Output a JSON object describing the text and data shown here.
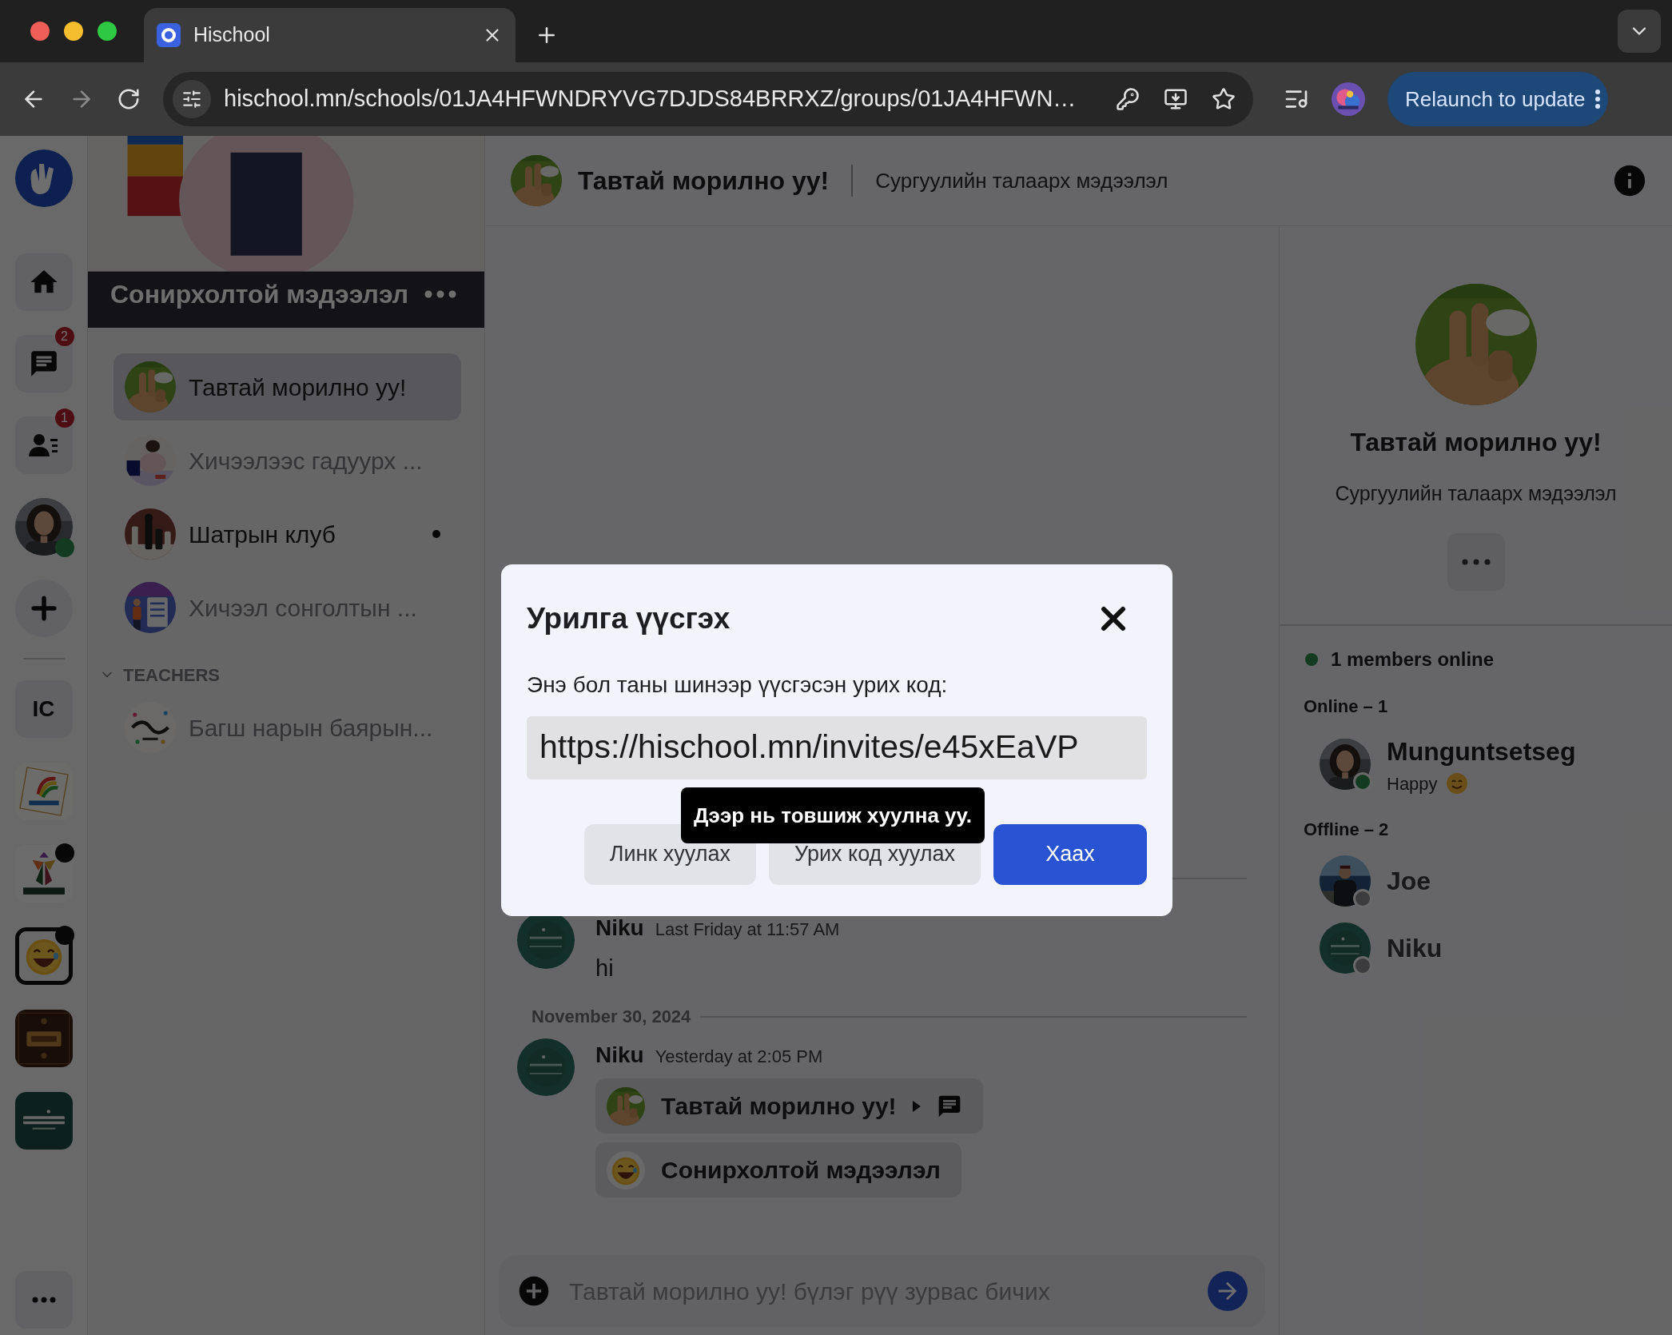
{
  "browser": {
    "tab_title": "Hischool",
    "url": "hischool.mn/schools/01JA4HFWNDRYVG7DJDS84BRRXZ/groups/01JA4HFWN…",
    "update_button": "Relaunch to update"
  },
  "rail": {
    "chat_badge": "2",
    "contacts_badge": "1",
    "user_online": true,
    "servers": [
      {
        "kind": "text",
        "label": "IC",
        "selected": false,
        "unread": false
      },
      {
        "kind": "picture",
        "selected": false,
        "unread": false
      },
      {
        "kind": "picture",
        "selected": false,
        "unread": true
      },
      {
        "kind": "picture",
        "selected": true,
        "unread": true
      },
      {
        "kind": "picture",
        "selected": false,
        "unread": false
      },
      {
        "kind": "picture",
        "selected": false,
        "unread": false
      }
    ]
  },
  "group": {
    "banner_title": "Сонирхолтой мэдээлэл",
    "channels": [
      {
        "name": "Тавтай морилно уу!",
        "selected": true,
        "unread": false
      },
      {
        "name": "Хичээлээс гадуурх ...",
        "selected": false,
        "unread": false
      },
      {
        "name": "Шатрын клуб",
        "selected": false,
        "unread": true
      },
      {
        "name": "Хичээл сонголтын ...",
        "selected": false,
        "unread": false
      }
    ],
    "categories": [
      {
        "name": "TEACHERS",
        "expanded": true,
        "channels": [
          {
            "name": "Багш нарын баярын...",
            "selected": false,
            "unread": false
          }
        ]
      }
    ]
  },
  "header": {
    "title": "Тавтай морилно уу!",
    "subtitle": "Сургуулийн талаарх мэдээлэл"
  },
  "messages": [
    {
      "kind": "message",
      "author": "Niku",
      "time": "Last Friday at 11:57 AM",
      "text": "hi"
    },
    {
      "kind": "date",
      "label": "November 30, 2024"
    },
    {
      "kind": "message",
      "author": "Niku",
      "time": "Yesterday at 2:05 PM",
      "channel_links": [
        {
          "name": "Тавтай морилно уу!",
          "expandable": true
        },
        {
          "name": "Сонирхолтой мэдээлэл",
          "expandable": false
        }
      ]
    }
  ],
  "composer": {
    "placeholder": "Тавтай морилно уу! бүлэг рүү зурвас бичих"
  },
  "info_panel": {
    "title": "Тавтай морилно уу!",
    "subtitle": "Сургуулийн талаарх мэдээлэл",
    "online_summary": "1 members online",
    "groups": [
      {
        "label": "Online – 1",
        "members": [
          {
            "name": "Munguntsetseg",
            "status_text": "Happy",
            "online": true
          }
        ]
      },
      {
        "label": "Offline – 2",
        "members": [
          {
            "name": "Joe",
            "online": false
          },
          {
            "name": "Niku",
            "online": false
          }
        ]
      }
    ]
  },
  "modal": {
    "title": "Урилга үүсгэх",
    "label": "Энэ бол таны шинээр үүсгэсэн урих код:",
    "invite_link": "https://hischool.mn/invites/e45xEaVP",
    "tooltip": "Дээр нь товшиж хуулна уу.",
    "buttons": [
      {
        "label": "Линк хуулах",
        "primary": false
      },
      {
        "label": "Урих код хуулах",
        "primary": false
      },
      {
        "label": "Хаах",
        "primary": true
      }
    ]
  }
}
